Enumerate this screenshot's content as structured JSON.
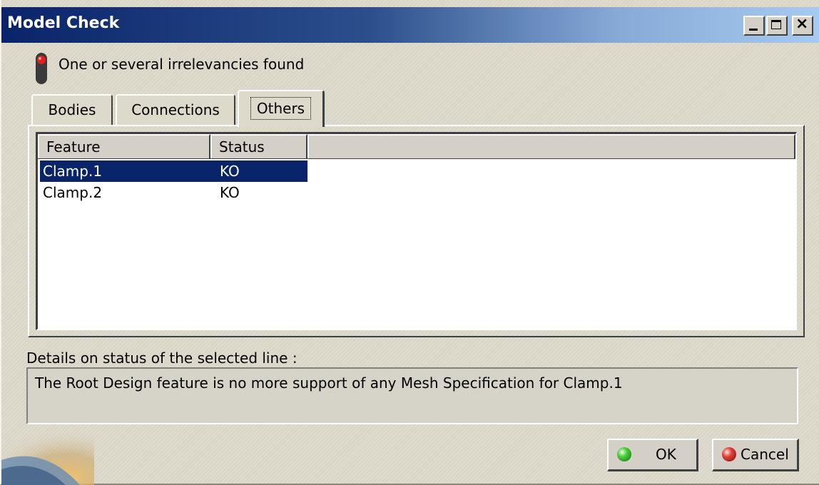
{
  "window": {
    "title": "Model Check",
    "colors": {
      "titlebar_start": "#0a246a",
      "titlebar_end": "#a6caf0",
      "background": "#ddd9cb",
      "selection": "#0a246a"
    }
  },
  "titlebar_buttons": {
    "minimize_icon": "minimize-icon",
    "maximize_icon": "maximize-icon",
    "close_icon": "close-icon",
    "close_glyph": "×"
  },
  "status": {
    "icon": "traffic-light-red-icon",
    "text": "One or several irrelevancies found"
  },
  "tabs": [
    {
      "label": "Bodies",
      "active": false
    },
    {
      "label": "Connections",
      "active": false
    },
    {
      "label": "Others",
      "active": true
    }
  ],
  "table": {
    "columns": [
      "Feature",
      "Status"
    ],
    "rows": [
      {
        "feature": "Clamp.1",
        "status": "KO",
        "selected": true
      },
      {
        "feature": "Clamp.2",
        "status": "KO",
        "selected": false
      }
    ]
  },
  "details": {
    "label": "Details on status of the selected line :",
    "text": "The Root Design feature is no more support of any Mesh Specification for Clamp.1"
  },
  "buttons": {
    "ok": {
      "label": "OK",
      "icon": "green-ball-icon"
    },
    "cancel": {
      "label": "Cancel",
      "icon": "red-ball-icon"
    }
  }
}
